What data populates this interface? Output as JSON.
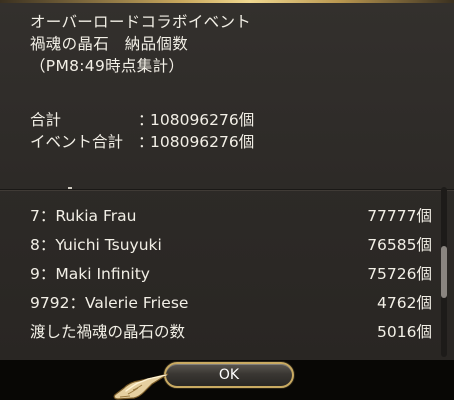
{
  "dialog": {
    "title_lines": [
      "オーバーロードコラボイベント",
      "禍魂の晶石　納品個数",
      "（PM8:49時点集計）"
    ],
    "totals": [
      {
        "label": "合計",
        "sep": "：",
        "value": "108096276個"
      },
      {
        "label": "イベント合計",
        "sep": "：",
        "value": "108096276個"
      }
    ],
    "ranking": [
      {
        "name": "7：Rukia Frau",
        "value": "77777個"
      },
      {
        "name": "8：Yuichi Tsuyuki",
        "value": "76585個"
      },
      {
        "name": "9：Maki Infinity",
        "value": "75726個"
      },
      {
        "name": "9792：Valerie Friese",
        "value": "4762個"
      }
    ],
    "delivered": {
      "label": "渡した禍魂の晶石の数",
      "value": "5016個"
    },
    "scroll_position": 0.5
  },
  "ok_button": {
    "label": "OK"
  },
  "icons": {
    "cursor": "pointing-hand-cursor-icon"
  },
  "colors": {
    "panel_bg": "#2d2a27",
    "text": "#f2efe6",
    "button_border": "#c9aa62",
    "gold_accent": "#d7b56b"
  }
}
